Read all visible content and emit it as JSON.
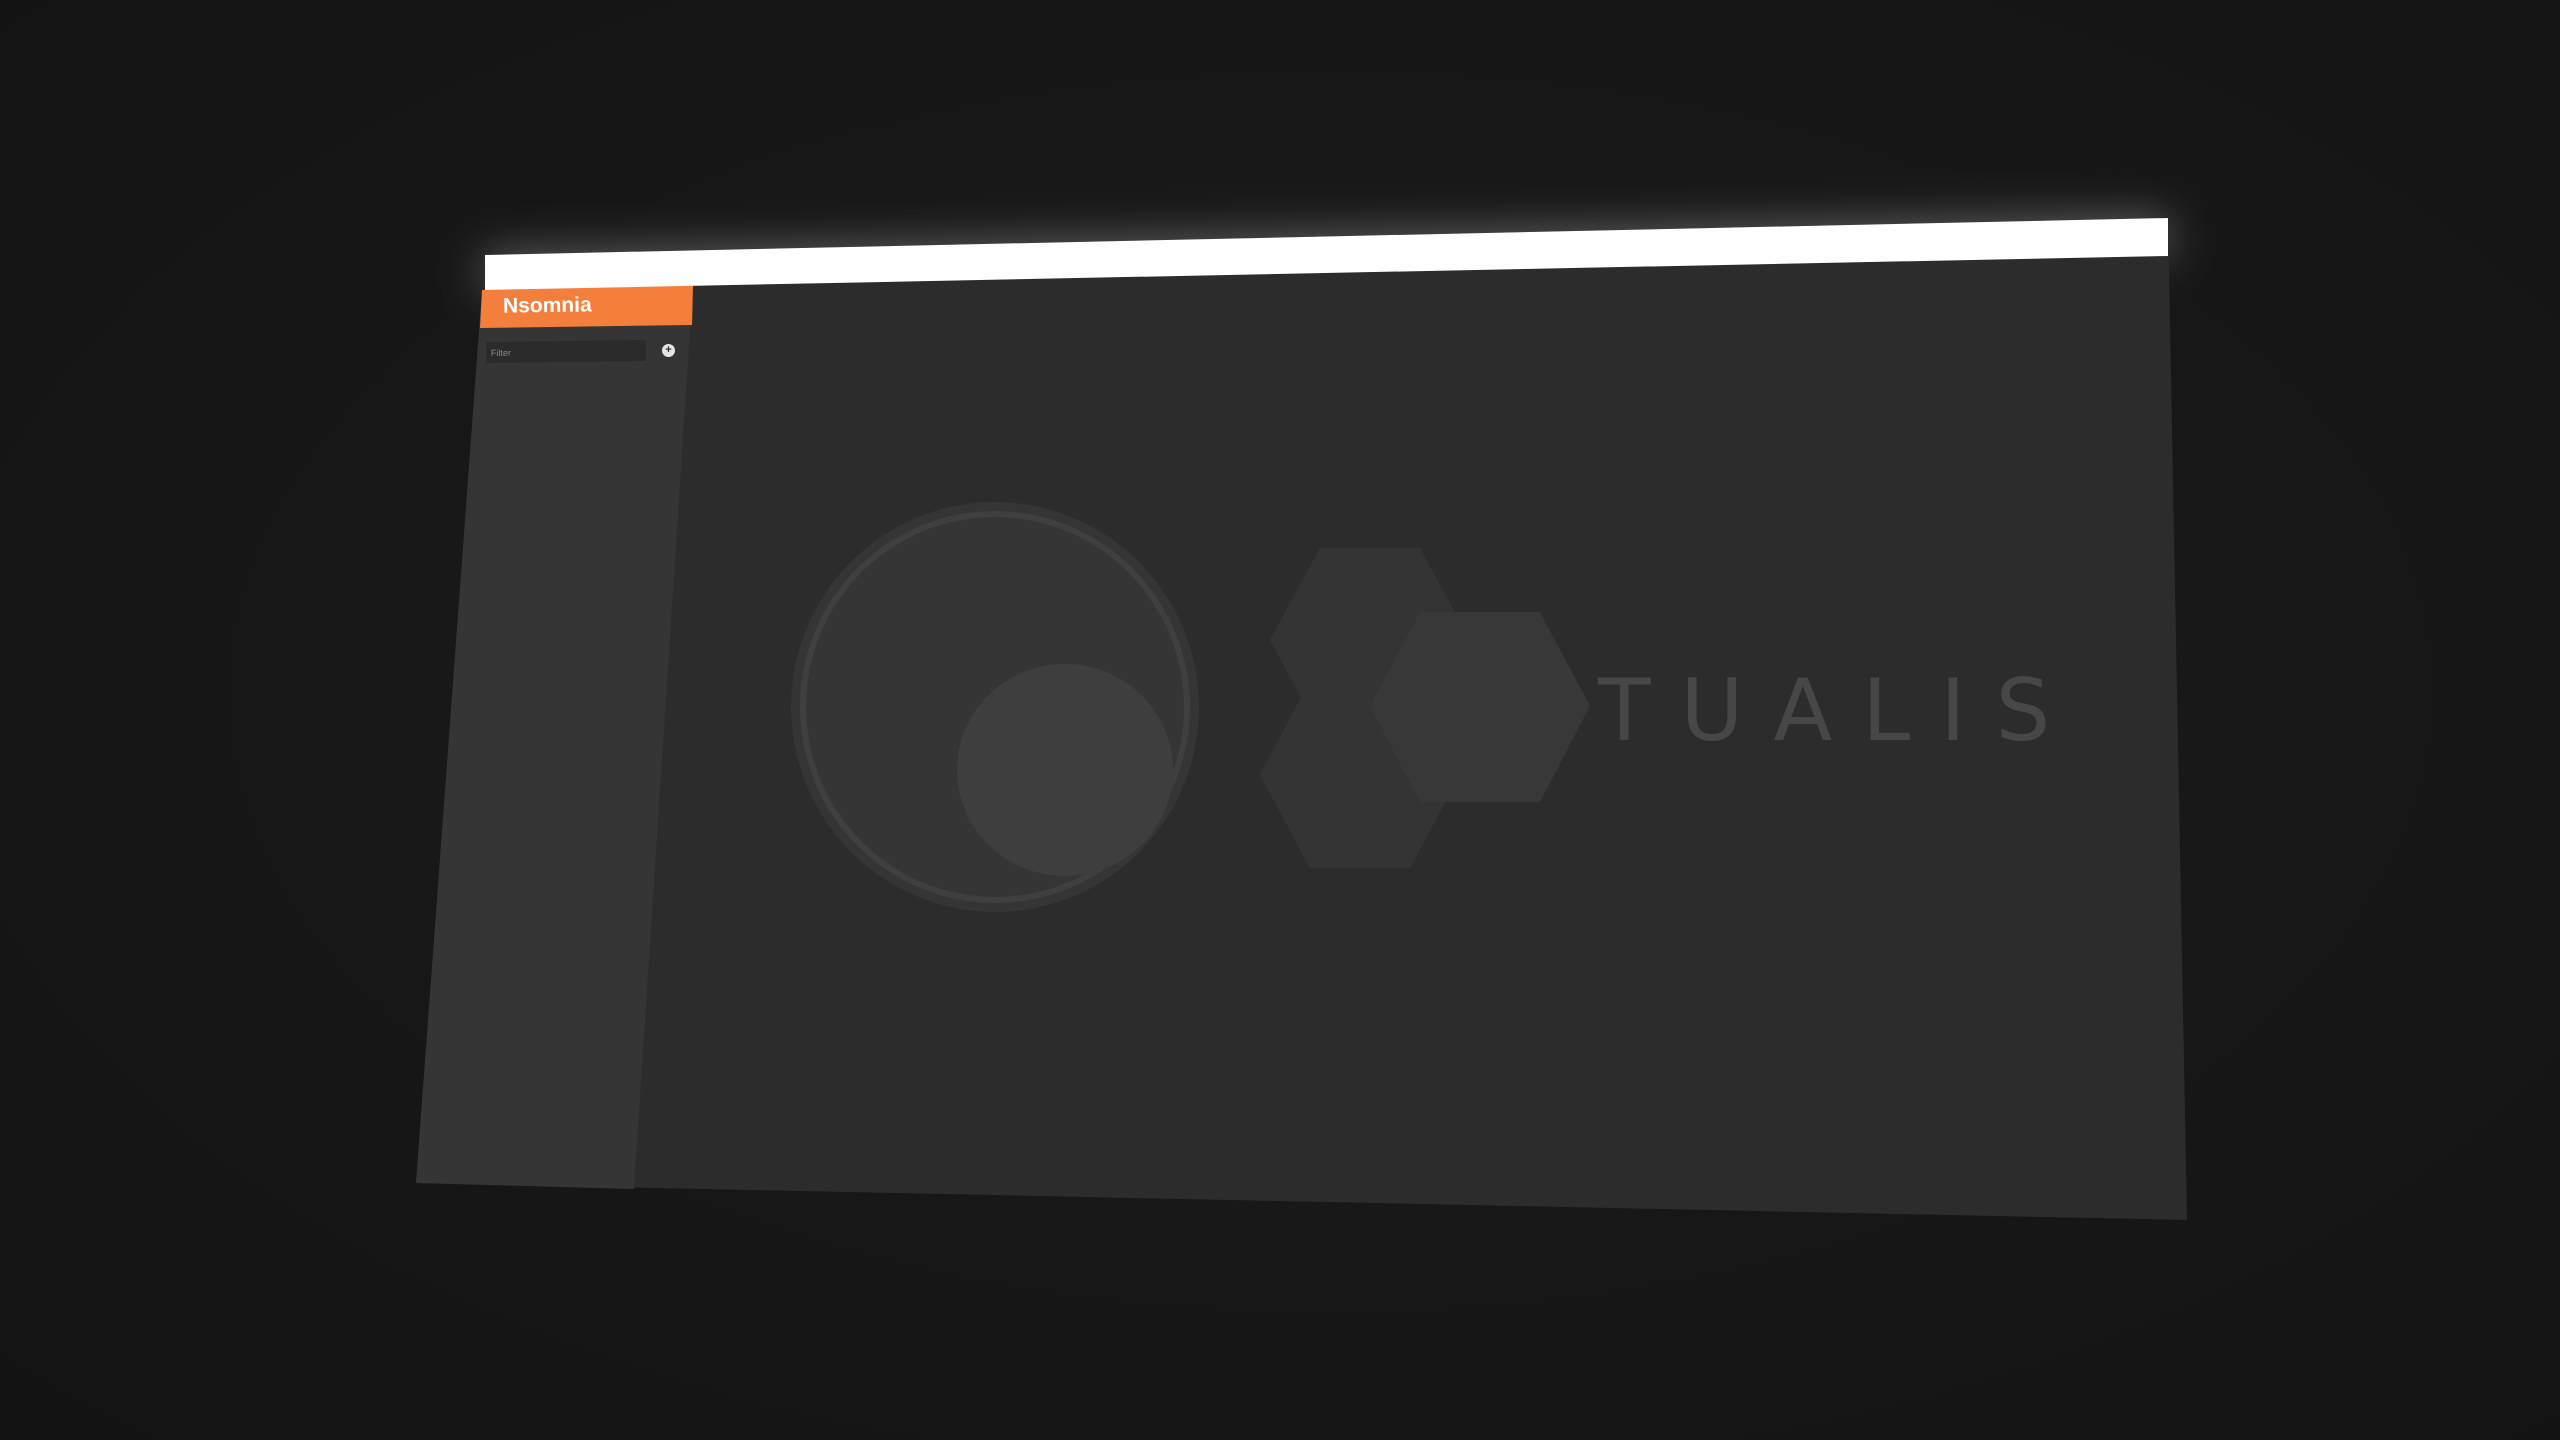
{
  "app": {
    "name": "Nsomnia"
  },
  "sidebar": {
    "filter_placeholder": "Filter",
    "add_button_icon": "plus-circle-icon"
  },
  "main": {
    "logo_text": "TUALIS",
    "logo_icon": "virtualis-logo-icon"
  },
  "colors": {
    "accent": "#f47f3c",
    "titlebar": "#ffffff",
    "main_bg": "#2c2c2c",
    "sidebar_bg": "#353535",
    "logo": "#474747",
    "background": "#161616"
  }
}
